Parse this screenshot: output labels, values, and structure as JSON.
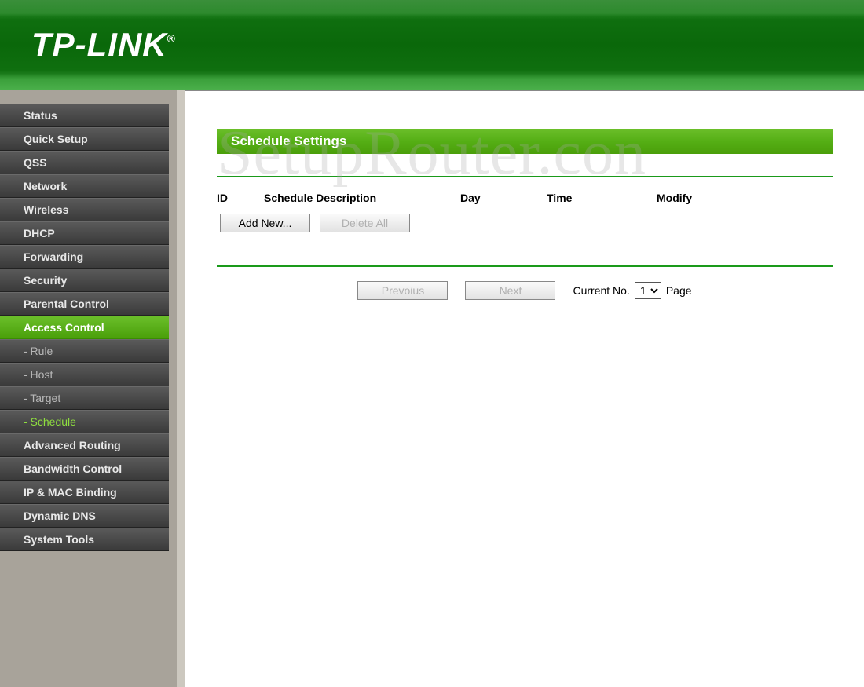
{
  "header": {
    "brand": "TP-LINK",
    "reg": "®"
  },
  "sidebar": {
    "items": [
      {
        "label": "Status"
      },
      {
        "label": "Quick Setup"
      },
      {
        "label": "QSS"
      },
      {
        "label": "Network"
      },
      {
        "label": "Wireless"
      },
      {
        "label": "DHCP"
      },
      {
        "label": "Forwarding"
      },
      {
        "label": "Security"
      },
      {
        "label": "Parental Control"
      },
      {
        "label": "Access Control",
        "active": true,
        "children": [
          {
            "label": "- Rule"
          },
          {
            "label": "- Host"
          },
          {
            "label": "- Target"
          },
          {
            "label": "- Schedule",
            "active": true
          }
        ]
      },
      {
        "label": "Advanced Routing"
      },
      {
        "label": "Bandwidth Control"
      },
      {
        "label": "IP & MAC Binding"
      },
      {
        "label": "Dynamic DNS"
      },
      {
        "label": "System Tools"
      }
    ]
  },
  "main": {
    "title": "Schedule Settings",
    "columns": {
      "id": "ID",
      "desc": "Schedule Description",
      "day": "Day",
      "time": "Time",
      "modify": "Modify"
    },
    "buttons": {
      "add_new": "Add New...",
      "delete_all": "Delete All",
      "previous": "Prevoius",
      "next": "Next"
    },
    "pager": {
      "current_label": "Current No.",
      "page_label": "Page",
      "current_value": "1",
      "options": [
        "1"
      ]
    }
  },
  "watermark": "SetupRouter.con"
}
